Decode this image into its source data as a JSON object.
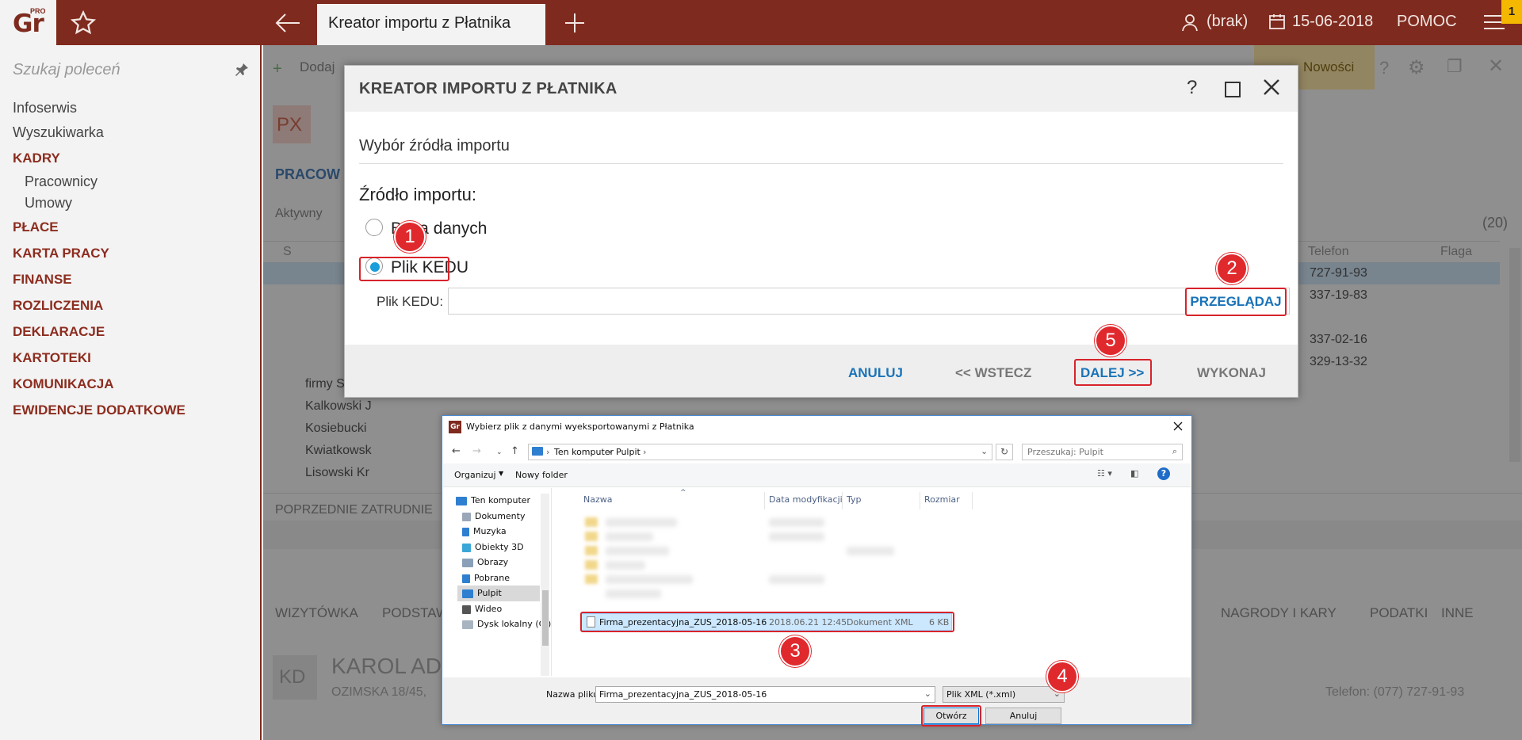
{
  "topbar": {
    "logo_text": "Gr",
    "logo_badge": "PRO",
    "active_tab": "Kreator importu z Płatnika",
    "user_label": "(brak)",
    "date": "15-06-2018",
    "help_label": "POMOC",
    "notification_count": "1"
  },
  "sidebar": {
    "search_placeholder": "Szukaj poleceń",
    "items": [
      {
        "label": "Infoserwis",
        "type": "link"
      },
      {
        "label": "Wyszukiwarka",
        "type": "link"
      },
      {
        "label": "KADRY",
        "type": "section"
      },
      {
        "label": "Pracownicy",
        "type": "sub"
      },
      {
        "label": "Umowy",
        "type": "sub"
      },
      {
        "label": "PŁACE",
        "type": "section"
      },
      {
        "label": "KARTA PRACY",
        "type": "section"
      },
      {
        "label": "FINANSE",
        "type": "section"
      },
      {
        "label": "ROZLICZENIA",
        "type": "section"
      },
      {
        "label": "DEKLARACJE",
        "type": "section"
      },
      {
        "label": "KARTOTEKI",
        "type": "section"
      },
      {
        "label": "KOMUNIKACJA",
        "type": "section"
      },
      {
        "label": "EWIDENCJE DODATKOWE",
        "type": "section"
      }
    ]
  },
  "background": {
    "toolbar_add": "Dodaj",
    "news_label": "Nowości",
    "avatar_px": "PX",
    "section_label": "PRACOW",
    "filter_label": "Aktywny",
    "count": "(20)",
    "col_s": "S",
    "col_phone": "Telefon",
    "col_flag": "Flaga",
    "phones": [
      "727-91-93",
      "337-19-83",
      "337-02-16",
      "329-13-32"
    ],
    "names": [
      "firmy Szef",
      "Kalkowski J",
      "Kosiebucki",
      "Kwiatkowsk",
      "Lisowski Kr"
    ],
    "prev_employment": "POPRZEDNIE ZATRUDNIE",
    "tabs": [
      "WIZYTÓWKA",
      "PODSTAW",
      "NAGRODY I KARY",
      "PODATKI",
      "INNE"
    ],
    "card_initials": "KD",
    "card_name": "KAROL AD",
    "card_address": "OZIMSKA 18/45,",
    "card_phone": "Telefon: (077) 727-91-93"
  },
  "wizard": {
    "title": "KREATOR IMPORTU Z PŁATNIKA",
    "help": "?",
    "step_title": "Wybór źródła importu",
    "source_label": "Źródło importu:",
    "option_db": "Baza danych",
    "option_kedu": "Plik KEDU",
    "selected_option": "Plik KEDU",
    "kedu_field_label": "Plik KEDU:",
    "kedu_field_value": "",
    "browse_button": "PRZEGLĄDAJ",
    "cancel_button": "ANULUJ",
    "back_button": "<< WSTECZ",
    "next_button": "DALEJ >>",
    "execute_button": "WYKONAJ"
  },
  "file_dialog": {
    "title": "Wybierz plik z danymi wyeksportowanymi z Płatnika",
    "logo": "Gr",
    "breadcrumb": [
      "Ten komputer",
      "Pulpit"
    ],
    "search_placeholder": "Przeszukaj: Pulpit",
    "organize_label": "Organizuj",
    "new_folder_label": "Nowy folder",
    "tree": [
      "Ten komputer",
      "Dokumenty",
      "Muzyka",
      "Obiekty 3D",
      "Obrazy",
      "Pobrane",
      "Pulpit",
      "Wideo",
      "Dysk lokalny (C:)"
    ],
    "selected_tree_item": "Pulpit",
    "columns": [
      "Nazwa",
      "Data modyfikacji",
      "Typ",
      "Rozmiar"
    ],
    "selected_file": {
      "name": "Firma_prezentacyjna_ZUS_2018-05-16",
      "date": "2018.06.21 12:45",
      "type": "Dokument XML",
      "size": "6 KB"
    },
    "filename_label": "Nazwa pliku:",
    "filename_value": "Firma_prezentacyjna_ZUS_2018-05-16",
    "filter_value": "Plik XML (*.xml)",
    "open_button": "Otwórz",
    "cancel_button": "Anuluj"
  },
  "annotations": [
    "1",
    "2",
    "3",
    "4",
    "5"
  ],
  "colors": {
    "brand": "#7f2a1e",
    "accent_blue": "#1a73b8",
    "highlight_red": "#d8232a",
    "radio_selected": "#1a9ddb"
  }
}
